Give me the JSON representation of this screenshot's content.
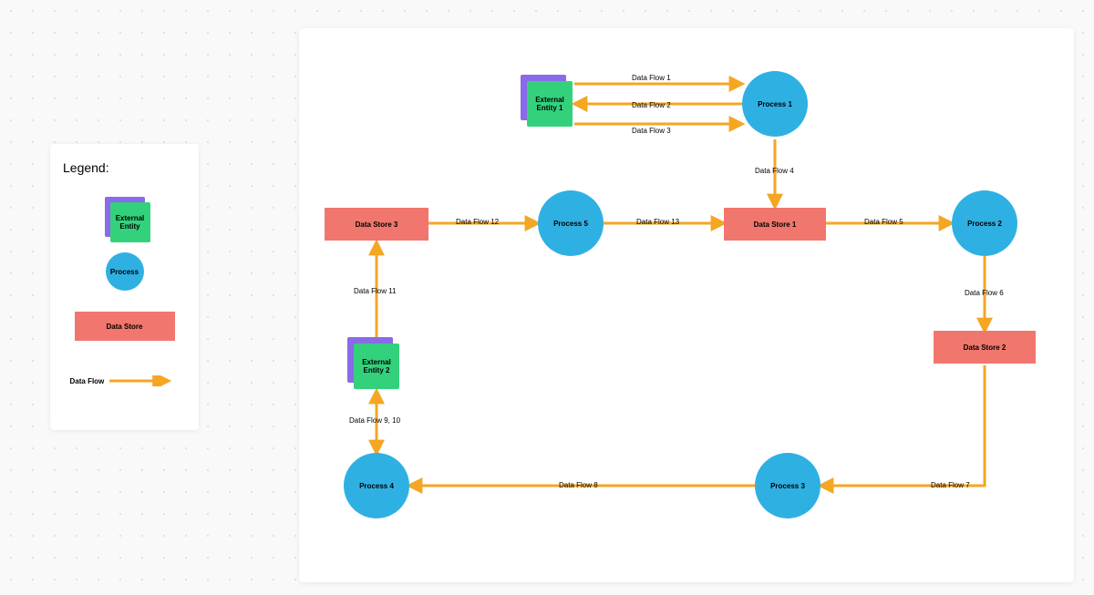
{
  "legend": {
    "title": "Legend:",
    "external_entity": "External Entity",
    "process": "Process",
    "data_store": "Data Store",
    "data_flow": "Data Flow"
  },
  "nodes": {
    "ext1": "External Entity 1",
    "ext2": "External Entity 2",
    "proc1": "Process 1",
    "proc2": "Process 2",
    "proc3": "Process 3",
    "proc4": "Process 4",
    "proc5": "Process 5",
    "store1": "Data Store 1",
    "store2": "Data Store 2",
    "store3": "Data Store 3"
  },
  "flows": {
    "f1": "Data Flow 1",
    "f2": "Data Flow 2",
    "f3": "Data Flow 3",
    "f4": "Data Flow 4",
    "f5": "Data Flow 5",
    "f6": "Data Flow 6",
    "f7": "Data Flow 7",
    "f8": "Data Flow 8",
    "f9_10": "Data Flow 9, 10",
    "f11": "Data Flow 11",
    "f12": "Data Flow 12",
    "f13": "Data Flow 13"
  },
  "chart_data": {
    "type": "data-flow-diagram",
    "entities": [
      {
        "id": "ext1",
        "kind": "external_entity",
        "label": "External Entity 1"
      },
      {
        "id": "ext2",
        "kind": "external_entity",
        "label": "External Entity 2"
      },
      {
        "id": "proc1",
        "kind": "process",
        "label": "Process 1"
      },
      {
        "id": "proc2",
        "kind": "process",
        "label": "Process 2"
      },
      {
        "id": "proc3",
        "kind": "process",
        "label": "Process 3"
      },
      {
        "id": "proc4",
        "kind": "process",
        "label": "Process 4"
      },
      {
        "id": "proc5",
        "kind": "process",
        "label": "Process 5"
      },
      {
        "id": "store1",
        "kind": "data_store",
        "label": "Data Store 1"
      },
      {
        "id": "store2",
        "kind": "data_store",
        "label": "Data Store 2"
      },
      {
        "id": "store3",
        "kind": "data_store",
        "label": "Data Store 3"
      }
    ],
    "flows": [
      {
        "label": "Data Flow 1",
        "from": "ext1",
        "to": "proc1"
      },
      {
        "label": "Data Flow 2",
        "from": "proc1",
        "to": "ext1"
      },
      {
        "label": "Data Flow 3",
        "from": "ext1",
        "to": "proc1"
      },
      {
        "label": "Data Flow 4",
        "from": "proc1",
        "to": "store1"
      },
      {
        "label": "Data Flow 5",
        "from": "store1",
        "to": "proc2"
      },
      {
        "label": "Data Flow 6",
        "from": "proc2",
        "to": "store2"
      },
      {
        "label": "Data Flow 7",
        "from": "store2",
        "to": "proc3"
      },
      {
        "label": "Data Flow 8",
        "from": "proc3",
        "to": "proc4"
      },
      {
        "label": "Data Flow 9",
        "from": "proc4",
        "to": "ext2"
      },
      {
        "label": "Data Flow 10",
        "from": "ext2",
        "to": "proc4"
      },
      {
        "label": "Data Flow 11",
        "from": "ext2",
        "to": "store3"
      },
      {
        "label": "Data Flow 12",
        "from": "store3",
        "to": "proc5"
      },
      {
        "label": "Data Flow 13",
        "from": "proc5",
        "to": "store1"
      }
    ]
  }
}
